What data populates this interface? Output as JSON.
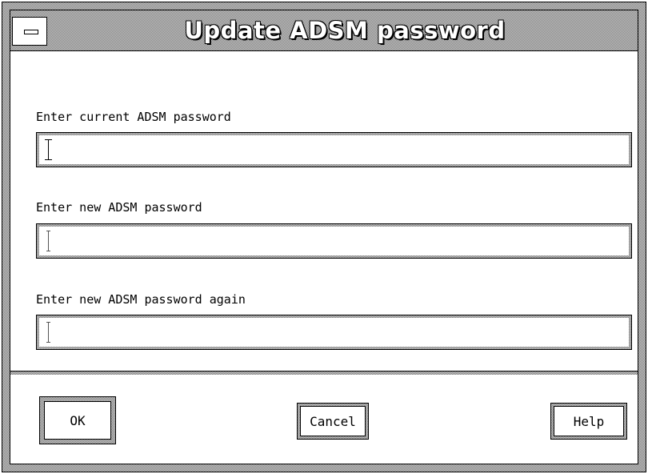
{
  "window": {
    "title": "Update ADSM password"
  },
  "fields": [
    {
      "label": "Enter current ADSM password",
      "value": ""
    },
    {
      "label": "Enter new ADSM password",
      "value": ""
    },
    {
      "label": "Enter new ADSM password again",
      "value": ""
    }
  ],
  "buttons": {
    "ok": "OK",
    "cancel": "Cancel",
    "help": "Help"
  }
}
